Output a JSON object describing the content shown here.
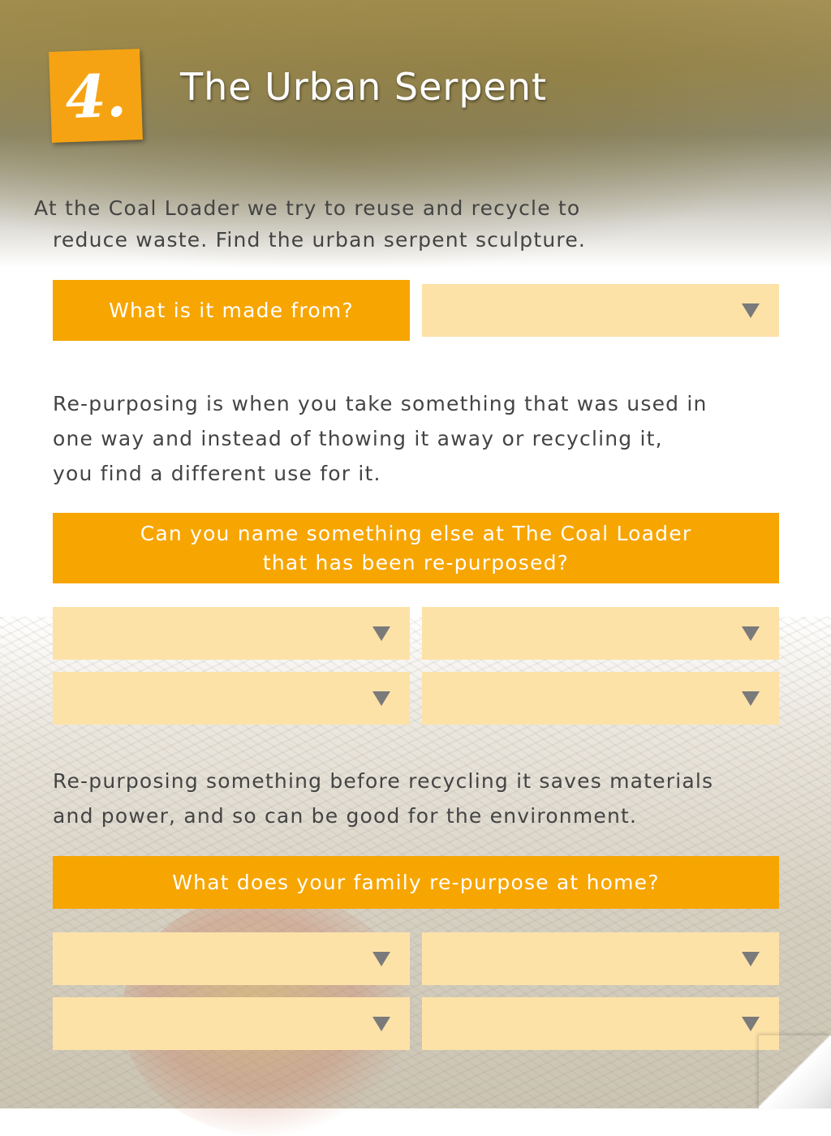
{
  "header": {
    "step_number": "4.",
    "title": "The Urban Serpent"
  },
  "intro": {
    "line1": "At the Coal Loader we try to reuse and recycle to",
    "line2": "reduce waste. Find the urban serpent sculpture."
  },
  "question1": {
    "label": "What is it made from?"
  },
  "paragraph1": {
    "line1": "Re-purposing is when you take something that was used in",
    "line2": "one way and instead of thowing it away or recycling it,",
    "line3": "you find a different use for it."
  },
  "question2": {
    "line1": "Can you name something else at The Coal Loader",
    "line2": "that has been re-purposed?"
  },
  "paragraph2": {
    "line1": "Re-purposing something before recycling it saves materials",
    "line2": "and power, and so can be good for the environment."
  },
  "question3": {
    "label": "What does your family re-purpose at home?"
  },
  "icons": {
    "dropdown_arrow": "triangle-down-icon",
    "page_curl": "page-curl-icon"
  },
  "colors": {
    "accent": "#f7a500",
    "dropdown_fill": "#fde2a8",
    "text": "#444444"
  }
}
